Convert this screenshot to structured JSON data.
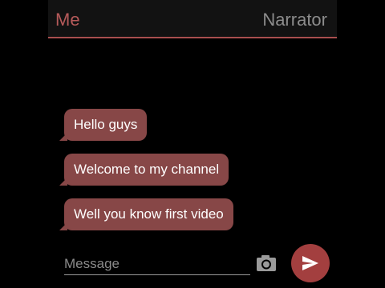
{
  "header": {
    "left_tab": "Me",
    "right_tab": "Narrator"
  },
  "messages": [
    {
      "text": "Hello guys"
    },
    {
      "text": "Welcome to my channel"
    },
    {
      "text": "Well you know first video"
    }
  ],
  "composer": {
    "placeholder": "Message",
    "camera_icon": "camera-icon",
    "send_icon": "send-icon"
  },
  "colors": {
    "accent": "#a94f4f",
    "bubble": "#874747",
    "send_button": "#a33f3f",
    "inactive_tab": "#8c8c8c"
  }
}
